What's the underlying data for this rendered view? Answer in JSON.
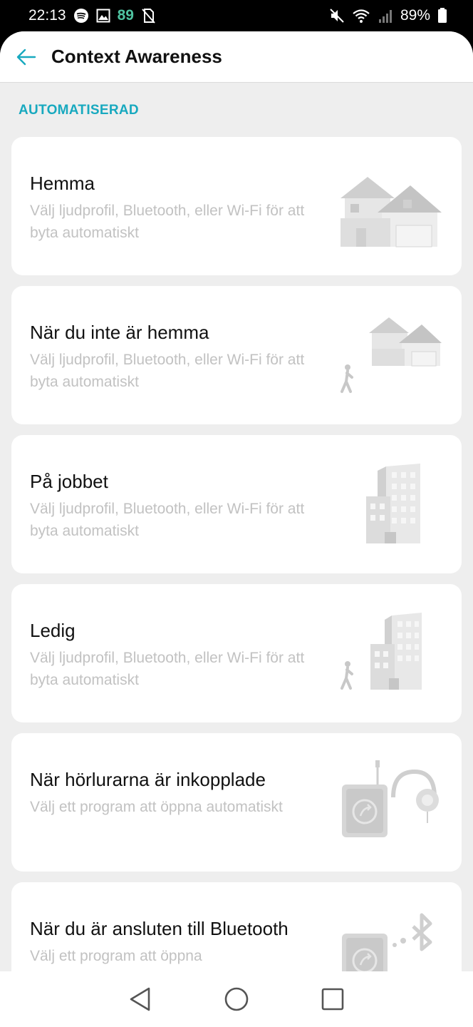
{
  "status_bar": {
    "time": "22:13",
    "notif_number": "89",
    "battery": "89%",
    "left_icons": [
      "spotify-icon",
      "image-icon",
      "no-sim-icon"
    ],
    "right_icons": [
      "mute-icon",
      "wifi-icon",
      "signal-icon",
      "battery-icon"
    ]
  },
  "app_bar": {
    "title": "Context Awareness",
    "back_icon": "arrow-left-icon"
  },
  "section": {
    "header": "AUTOMATISERAD"
  },
  "cards": [
    {
      "title": "Hemma",
      "desc": "Välj ljudprofil, Bluetooth, eller Wi-Fi för att byta automatiskt",
      "illustration": "house-icon"
    },
    {
      "title": "När du inte är hemma",
      "desc": "Välj ljudprofil, Bluetooth, eller Wi-Fi för att byta automatiskt",
      "illustration": "walking-away-house-icon"
    },
    {
      "title": "På jobbet",
      "desc": "Välj ljudprofil, Bluetooth, eller Wi-Fi för att byta automatiskt",
      "illustration": "office-building-icon"
    },
    {
      "title": "Ledig",
      "desc": "Välj ljudprofil, Bluetooth, eller Wi-Fi för att byta automatiskt",
      "illustration": "walking-away-building-icon"
    },
    {
      "title": "När hörlurarna är inkopplade",
      "desc": "Välj ett program att öppna automatiskt",
      "illustration": "headphones-phone-icon"
    },
    {
      "title": "När du är ansluten till Bluetooth",
      "desc": "Välj ett program att öppna",
      "illustration": "bluetooth-phone-icon"
    }
  ],
  "nav_bar": {
    "icons": [
      "back-triangle-icon",
      "home-circle-icon",
      "recents-square-icon"
    ]
  },
  "colors": {
    "accent": "#18a9bf",
    "background": "#eeeeee",
    "card": "#ffffff",
    "description_text": "#c2c2c2"
  }
}
